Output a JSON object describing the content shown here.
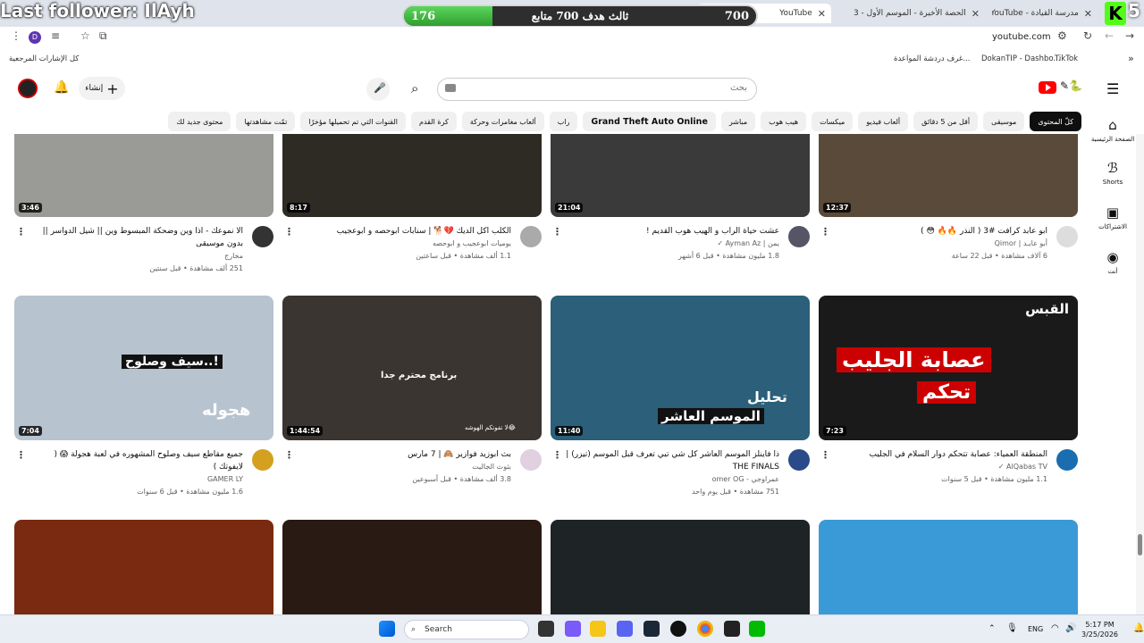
{
  "browser": {
    "tabs": [
      {
        "label": "مدرسة القيادة - YouTube",
        "active": false
      },
      {
        "label": "الحصة الأخيرة - الموسم الأول - 3",
        "active": false
      },
      {
        "label": "YouTube",
        "active": true
      }
    ],
    "url": "youtube.com",
    "profile_letter": "D"
  },
  "overlay": {
    "last_follower": "Last follower: IlAyh",
    "goal_text": "ثالث هدف 700 متابع",
    "goal_current": "176",
    "goal_max": "700",
    "goal_fraction": 0.2514,
    "kick_logo": "K",
    "kick_count": "5"
  },
  "bookmarks": {
    "items": [
      "TikTok",
      "DokanTIP - Dashbo...",
      "غرف دردشة المواعدة...",
      "كل الإشارات المرجعية"
    ]
  },
  "header": {
    "search_placeholder": "بحث",
    "create_label": "إنشاء"
  },
  "chips": [
    {
      "label": "كلّ المحتوى",
      "selected": true,
      "bold": false
    },
    {
      "label": "موسيقى",
      "selected": false,
      "bold": false
    },
    {
      "label": "أقل من 5 دقائق",
      "selected": false,
      "bold": false
    },
    {
      "label": "ألعاب فيديو",
      "selected": false,
      "bold": false
    },
    {
      "label": "ميكسات",
      "selected": false,
      "bold": false
    },
    {
      "label": "هيب هوب",
      "selected": false,
      "bold": false
    },
    {
      "label": "مباشر",
      "selected": false,
      "bold": false
    },
    {
      "label": "Grand Theft Auto Online",
      "selected": false,
      "bold": true
    },
    {
      "label": "راب",
      "selected": false,
      "bold": false
    },
    {
      "label": "ألعاب مغامرات وحركة",
      "selected": false,
      "bold": false
    },
    {
      "label": "كرة القدم",
      "selected": false,
      "bold": false
    },
    {
      "label": "القنوات التي تم تحميلها مؤخرًا",
      "selected": false,
      "bold": false
    },
    {
      "label": "تمّت مشاهدتها",
      "selected": false,
      "bold": false
    },
    {
      "label": "محتوى جديد لك",
      "selected": false,
      "bold": false
    }
  ],
  "sidebar": {
    "items": [
      {
        "label": "الصفحة الرئيسية",
        "icon": "home-icon"
      },
      {
        "label": "Shorts",
        "icon": "shorts-icon"
      },
      {
        "label": "الاشتراكات",
        "icon": "subscriptions-icon"
      },
      {
        "label": "أنت",
        "icon": "you-icon"
      }
    ]
  },
  "videos": [
    {
      "title": "ابو عابد كرافت #3 ( النذر 🔥🔥 😳 )",
      "channel": "أبو عابـد | Qimor",
      "meta": "6 آلاف مشاهدة • قبل 22 ساعة",
      "duration": "12:37",
      "thumb": "#5a4a3a",
      "avatar": "#ddd"
    },
    {
      "title": "عشت حياة الراب و الهيب هوب القديم !",
      "channel": "يمن | Ayman Az ✓",
      "meta": "1.8 مليون مشاهدة • قبل 6 أشهر",
      "duration": "21:04",
      "thumb": "#3a3a3a",
      "avatar": "#556"
    },
    {
      "title": "الكلب اكل الديك 💔🐕 | سنابات ابوحصه و ابوعجيب",
      "channel": "يوميات ابوعجيب و ابوحصه",
      "meta": "1.1 ألف مشاهدة • قبل ساعتين",
      "duration": "8:17",
      "thumb": "#2e2a24",
      "avatar": "#aaa"
    },
    {
      "title": "الا نموعك - اذا وين وضحكة المبسوط وين || شيل الدواسر || بدون موسيقى",
      "channel": "مخارج",
      "meta": "251 ألف مشاهدة • قبل سنتين",
      "duration": "3:46",
      "thumb": "#9a9a96",
      "avatar": "#333"
    },
    {
      "title": "المنطقة العمياء: عصابة تتحكم دوار السلام في الجليب",
      "channel": "AlQabas TV ✓",
      "meta": "1.1 مليون مشاهدة • قبل 5 سنوات",
      "duration": "7:23",
      "thumb": "#1a1a1a",
      "avatar": "#1a6db0"
    },
    {
      "title": "ذا فاينلز الموسم العاشر كل شي تبي تعرف قبل الموسم (تيزر) | THE FINALS",
      "channel": "عمراوجي - omer OG",
      "meta": "751 مشاهدة • قبل يوم واحد",
      "duration": "11:40",
      "thumb": "#2b5f7a",
      "avatar": "#2a4a8a"
    },
    {
      "title": "بث ابوزيد فوازير 🙈 | 7 مارس",
      "channel": "بثوث الجاليت",
      "meta": "3.8 ألف مشاهدة • قبل أسبوعين",
      "duration": "1:44:54",
      "thumb": "#3a3530",
      "avatar": "#e0d0e0"
    },
    {
      "title": "جميع مقاطع سيف وصلوح المشهوره في لعبة هجولة 😱 ( لايفوتك )",
      "channel": "GAMER LY",
      "meta": "1.6 مليون مشاهدة • قبل 6 سنوات",
      "duration": "7:04",
      "thumb": "#b7c3cf",
      "avatar": "#d4a020"
    },
    {
      "title": "",
      "channel": "",
      "meta": "",
      "duration": "",
      "thumb": "#3a9ad8",
      "avatar": "#fff"
    },
    {
      "title": "",
      "channel": "",
      "meta": "",
      "duration": "",
      "thumb": "#1e2326",
      "avatar": "#fff"
    },
    {
      "title": "",
      "channel": "",
      "meta": "",
      "duration": "",
      "thumb": "#2a1a14",
      "avatar": "#fff"
    },
    {
      "title": "",
      "channel": "",
      "meta": "",
      "duration": "",
      "thumb": "#7a2a10",
      "avatar": "#fff"
    }
  ],
  "thumb_texts": {
    "v5a": "القبس",
    "v5b": "عصابة الجليب",
    "v5c": "تحكم",
    "v6a": "تحليل",
    "v6b": "الموسم العاشر",
    "v7a": "برنامج محترم جدا",
    "v7b": "لا تفوتكم الهوشه😂",
    "v8a": "سيف وصلوح..!",
    "v8b": "هجوله"
  },
  "taskbar": {
    "search_label": "Search",
    "lang": "ENG",
    "time": "5:17 PM",
    "date": "3/25/2026"
  },
  "colors": {
    "yt_red": "#ff0000",
    "goal_green": "#3cb043",
    "kick_green": "#53fc18"
  }
}
